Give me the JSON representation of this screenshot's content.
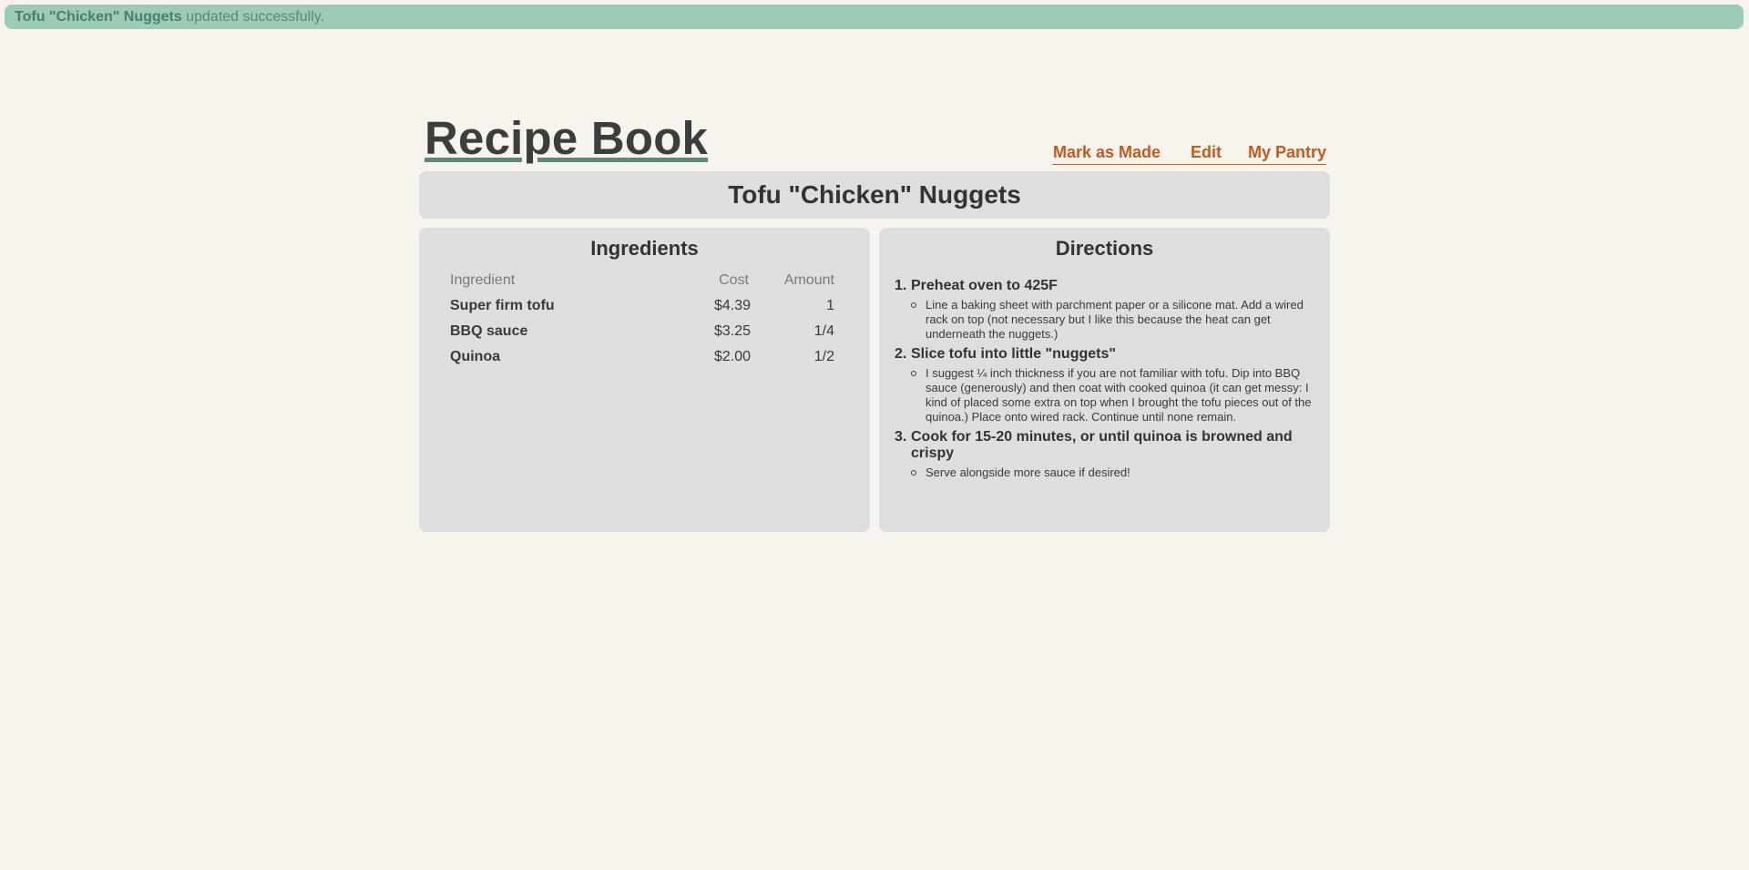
{
  "flash": {
    "item_name": "Tofu \"Chicken\" Nuggets",
    "message": "updated successfully."
  },
  "header": {
    "site_title": "Recipe Book",
    "nav": [
      "Mark as Made",
      "Edit",
      "My Pantry"
    ]
  },
  "recipe": {
    "title": "Tofu \"Chicken\" Nuggets"
  },
  "ingredients": {
    "heading": "Ingredients",
    "columns": [
      "Ingredient",
      "Cost",
      "Amount"
    ],
    "rows": [
      {
        "name": "Super firm tofu",
        "cost": "$4.39",
        "amount": "1"
      },
      {
        "name": "BBQ sauce",
        "cost": "$3.25",
        "amount": "1/4"
      },
      {
        "name": "Quinoa",
        "cost": "$2.00",
        "amount": "1/2"
      }
    ]
  },
  "directions": {
    "heading": "Directions",
    "steps": [
      {
        "num": "1.",
        "title": "Preheat oven to 425F",
        "detail": "Line a baking sheet with parchment paper or a silicone mat. Add a wired rack on top (not necessary but I like this because the heat can get underneath the nuggets.)"
      },
      {
        "num": "2.",
        "title": "Slice tofu into little \"nuggets\"",
        "detail": "I suggest ¼ inch thickness if you are not familiar with tofu. Dip into BBQ sauce (generously) and then coat with cooked quinoa (it can get messy: I kind of placed some extra on top when I brought the tofu pieces out of the quinoa.) Place onto wired rack. Continue until none remain."
      },
      {
        "num": "3.",
        "title": "Cook for 15-20 minutes, or until quinoa is browned and crispy",
        "detail": "Serve alongside more sauce if desired!"
      }
    ]
  }
}
